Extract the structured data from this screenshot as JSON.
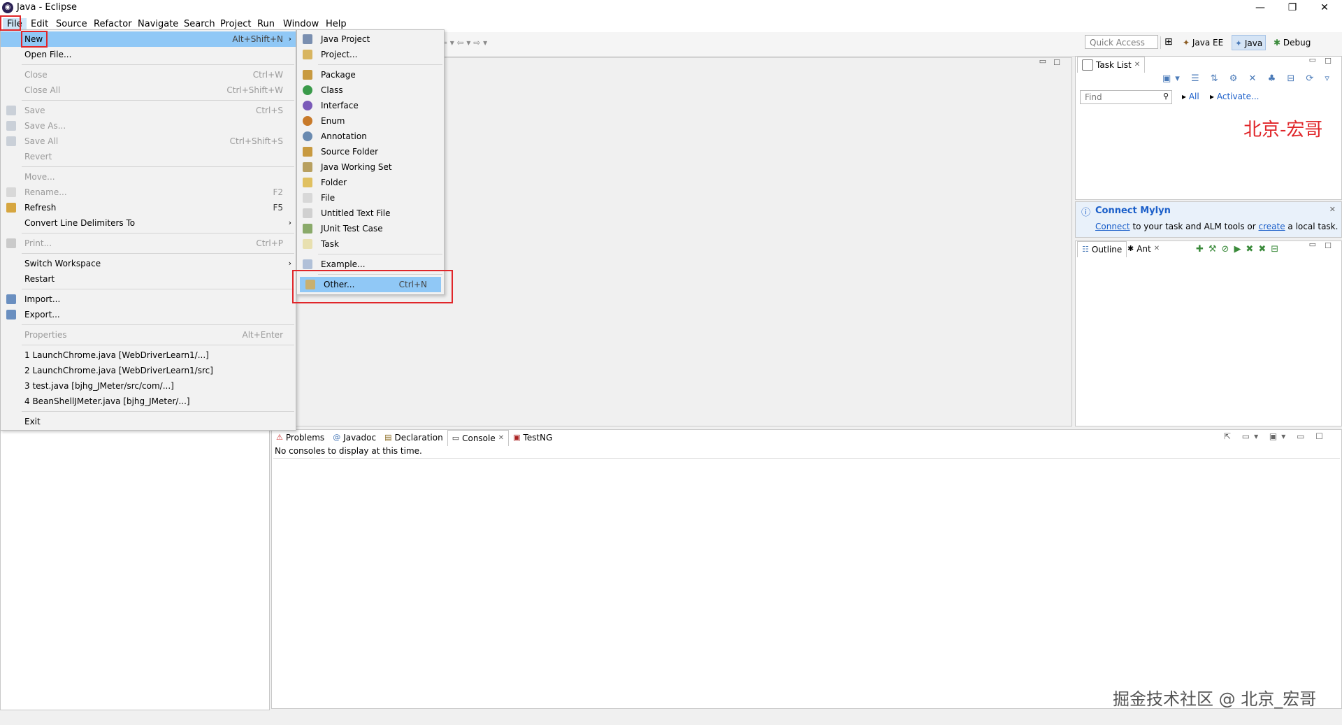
{
  "window": {
    "title": "Java - Eclipse",
    "app_icon": "eclipse-icon",
    "controls": [
      "—",
      "❐",
      "✕"
    ]
  },
  "menubar": [
    "File",
    "Edit",
    "Source",
    "Refactor",
    "Navigate",
    "Search",
    "Project",
    "Run",
    "Window",
    "Help"
  ],
  "toolbar": {
    "quick_access_placeholder": "Quick Access",
    "perspectives": [
      {
        "label": "Java EE"
      },
      {
        "label": "Java",
        "selected": true
      },
      {
        "label": "Debug"
      }
    ]
  },
  "file_menu": {
    "items": [
      {
        "label": "New",
        "shortcut": "Alt+Shift+N",
        "submenu": true,
        "highlighted": true
      },
      {
        "label": "Open File..."
      },
      {
        "sep": true
      },
      {
        "label": "Close",
        "shortcut": "Ctrl+W",
        "disabled": true
      },
      {
        "label": "Close All",
        "shortcut": "Ctrl+Shift+W",
        "disabled": true
      },
      {
        "sep": true
      },
      {
        "label": "Save",
        "shortcut": "Ctrl+S",
        "disabled": true,
        "icon": "save-icon"
      },
      {
        "label": "Save As...",
        "disabled": true,
        "icon": "save-as-icon"
      },
      {
        "label": "Save All",
        "shortcut": "Ctrl+Shift+S",
        "disabled": true,
        "icon": "save-all-icon"
      },
      {
        "label": "Revert",
        "disabled": true
      },
      {
        "sep": true
      },
      {
        "label": "Move...",
        "disabled": true
      },
      {
        "label": "Rename...",
        "shortcut": "F2",
        "disabled": true,
        "icon": "rename-icon"
      },
      {
        "label": "Refresh",
        "shortcut": "F5",
        "icon": "refresh-icon"
      },
      {
        "label": "Convert Line Delimiters To",
        "submenu": true
      },
      {
        "sep": true
      },
      {
        "label": "Print...",
        "shortcut": "Ctrl+P",
        "disabled": true,
        "icon": "print-icon"
      },
      {
        "sep": true
      },
      {
        "label": "Switch Workspace",
        "submenu": true
      },
      {
        "label": "Restart"
      },
      {
        "sep": true
      },
      {
        "label": "Import...",
        "icon": "import-icon"
      },
      {
        "label": "Export...",
        "icon": "export-icon"
      },
      {
        "sep": true
      },
      {
        "label": "Properties",
        "shortcut": "Alt+Enter",
        "disabled": true
      },
      {
        "sep": true
      },
      {
        "label": "1 LaunchChrome.java  [WebDriverLearn1/...]"
      },
      {
        "label": "2 LaunchChrome.java  [WebDriverLearn1/src]"
      },
      {
        "label": "3 test.java  [bjhg_JMeter/src/com/...]"
      },
      {
        "label": "4 BeanShellJMeter.java  [bjhg_JMeter/...]"
      },
      {
        "sep": true
      },
      {
        "label": "Exit"
      }
    ]
  },
  "new_submenu": {
    "items": [
      {
        "label": "Java Project",
        "icon": "java-project-icon"
      },
      {
        "label": "Project...",
        "icon": "project-icon"
      },
      {
        "sep": true
      },
      {
        "label": "Package",
        "icon": "package-icon"
      },
      {
        "label": "Class",
        "icon": "class-icon"
      },
      {
        "label": "Interface",
        "icon": "interface-icon"
      },
      {
        "label": "Enum",
        "icon": "enum-icon"
      },
      {
        "label": "Annotation",
        "icon": "annotation-icon"
      },
      {
        "label": "Source Folder",
        "icon": "source-folder-icon"
      },
      {
        "label": "Java Working Set",
        "icon": "working-set-icon"
      },
      {
        "label": "Folder",
        "icon": "folder-icon"
      },
      {
        "label": "File",
        "icon": "file-icon"
      },
      {
        "label": "Untitled Text File",
        "icon": "text-file-icon"
      },
      {
        "label": "JUnit Test Case",
        "icon": "junit-icon"
      },
      {
        "label": "Task",
        "icon": "task-icon"
      },
      {
        "sep": true
      },
      {
        "label": "Example...",
        "icon": "example-icon"
      },
      {
        "sep": true
      },
      {
        "label": "Other...",
        "shortcut": "Ctrl+N",
        "icon": "wizard-icon",
        "highlighted": true
      }
    ]
  },
  "task_list": {
    "tab": "Task List",
    "find_placeholder": "Find",
    "all_label": "All",
    "activate_label": "Activate...",
    "watermark_red": "北京-宏哥"
  },
  "mylyn": {
    "title": "Connect Mylyn",
    "connect": "Connect",
    "middle": " to your task and ALM tools or ",
    "create": "create",
    "end": " a local task."
  },
  "outline": {
    "tabs": [
      "Outline",
      "Ant"
    ]
  },
  "bottom_panel": {
    "tabs": [
      "Problems",
      "Javadoc",
      "Declaration",
      "Console",
      "TestNG"
    ],
    "active_tab": "Console",
    "message": "No consoles to display at this time."
  },
  "watermark": "掘金技术社区 @ 北京_宏哥",
  "colors": {
    "highlight": "#90c8f6",
    "red_box": "#e0262a",
    "link": "#1a5ec9",
    "eclipse_purple": "#2c2255"
  }
}
